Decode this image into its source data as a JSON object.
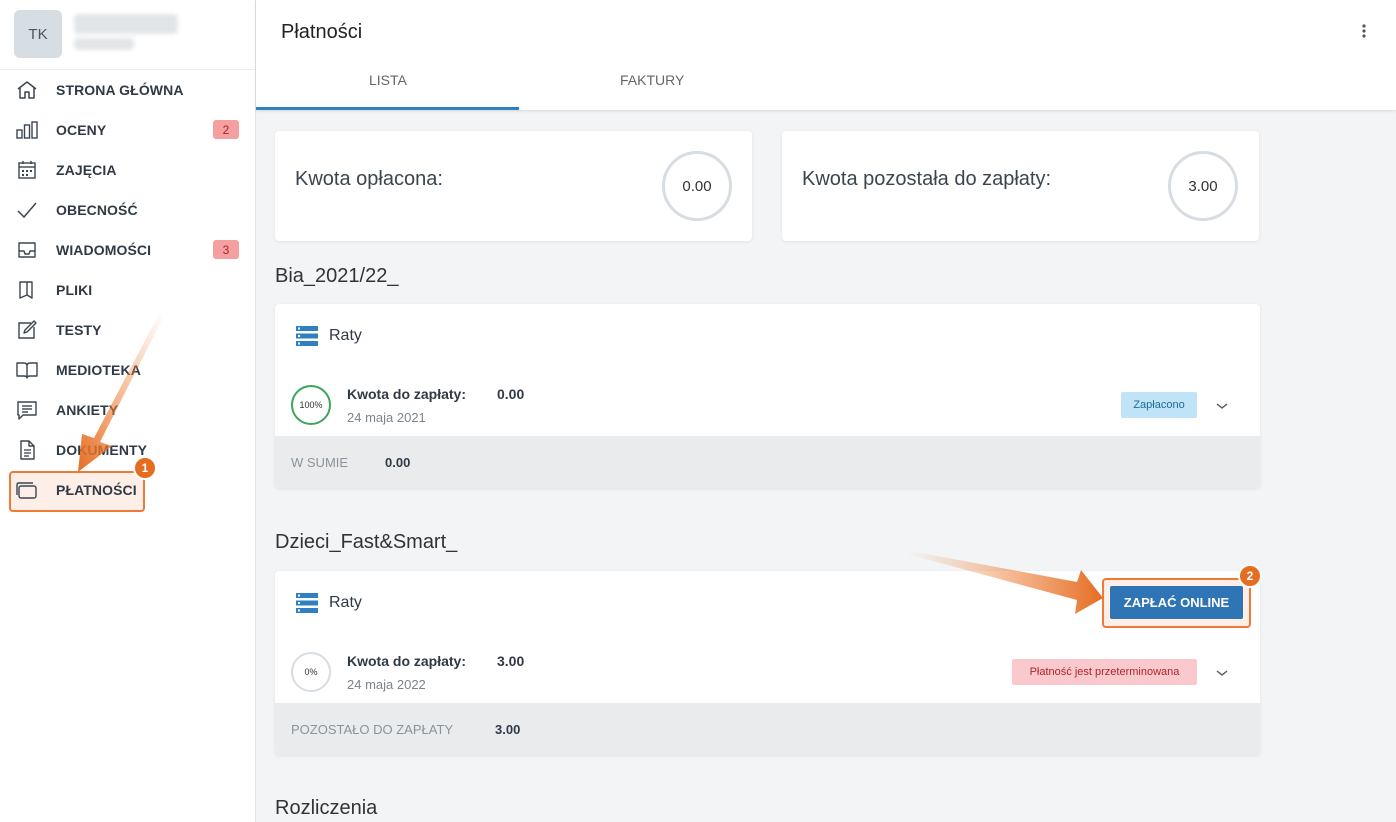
{
  "user": {
    "initials": "TK"
  },
  "sidebar": {
    "items": [
      {
        "label": "STRONA GŁÓWNA",
        "icon": "home-icon"
      },
      {
        "label": "OCENY",
        "icon": "bar-chart-icon",
        "badge": "2"
      },
      {
        "label": "ZAJĘCIA",
        "icon": "calendar-icon"
      },
      {
        "label": "OBECNOŚĆ",
        "icon": "check-icon"
      },
      {
        "label": "WIADOMOŚCI",
        "icon": "inbox-icon",
        "badge": "3"
      },
      {
        "label": "PLIKI",
        "icon": "file-icon"
      },
      {
        "label": "TESTY",
        "icon": "edit-icon"
      },
      {
        "label": "MEDIOTEKA",
        "icon": "book-icon"
      },
      {
        "label": "ANKIETY",
        "icon": "survey-icon"
      },
      {
        "label": "DOKUMENTY",
        "icon": "document-icon"
      },
      {
        "label": "PŁATNOŚCI",
        "icon": "wallet-icon",
        "active": true
      }
    ]
  },
  "header": {
    "title": "Płatności",
    "tabs": [
      {
        "label": "LISTA",
        "active": true
      },
      {
        "label": "FAKTURY"
      }
    ]
  },
  "summary": {
    "paid_label": "Kwota opłacona:",
    "paid_value": "0.00",
    "remaining_label": "Kwota pozostała do zapłaty:",
    "remaining_value": "3.00"
  },
  "groups": [
    {
      "name": "Bia_2021/22_",
      "section_label": "Raty",
      "installment": {
        "percent": "100%",
        "amount_label": "Kwota do zapłaty:",
        "amount": "0.00",
        "date": "24 maja 2021",
        "status": "Zapłacono"
      },
      "footer_label": "W SUMIE",
      "footer_value": "0.00"
    },
    {
      "name": "Dzieci_Fast&Smart_",
      "section_label": "Raty",
      "pay_button": "ZAPŁAĆ ONLINE",
      "installment": {
        "percent": "0%",
        "amount_label": "Kwota do zapłaty:",
        "amount": "3.00",
        "date": "24 maja 2022",
        "status": "Płatność jest przeterminowana"
      },
      "footer_label": "POZOSTAŁO DO ZAPŁATY",
      "footer_value": "3.00"
    }
  ],
  "settlements": {
    "title": "Rozliczenia"
  },
  "annotations": {
    "marker1": "1",
    "marker2": "2"
  },
  "colors": {
    "accent": "#2f7fc1",
    "highlight": "#ee7a37",
    "paid_bg": "#bfe3f7",
    "overdue_bg": "#f9c9ce"
  }
}
